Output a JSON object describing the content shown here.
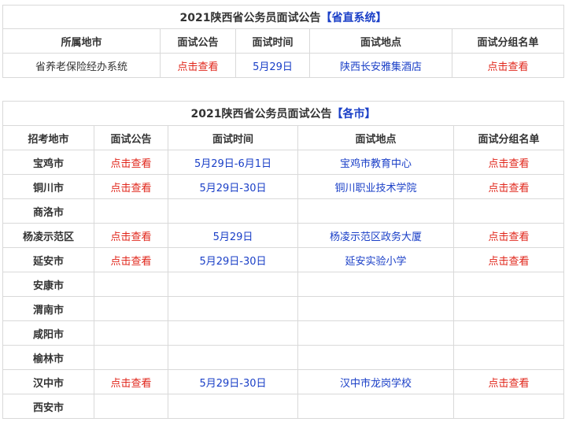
{
  "table1": {
    "title": "2021陕西省公务员面试公告",
    "title_accent": "【省直系统】",
    "headers": [
      "所属地市",
      "面试公告",
      "面试时间",
      "面试地点",
      "面试分组名单"
    ],
    "row": {
      "region": "省养老保险经办系统",
      "notice": "点击查看",
      "date": "5月29日",
      "place": "陕西长安雅集酒店",
      "groups": "点击查看"
    }
  },
  "table2": {
    "title": "2021陕西省公务员面试公告",
    "title_accent": "【各市】",
    "headers": [
      "招考地市",
      "面试公告",
      "面试时间",
      "面试地点",
      "面试分组名单"
    ],
    "rows": [
      {
        "city": "宝鸡市",
        "notice": "点击查看",
        "date": "5月29日-6月1日",
        "place": "宝鸡市教育中心",
        "groups": "点击查看"
      },
      {
        "city": "铜川市",
        "notice": "点击查看",
        "date": "5月29日-30日",
        "place": "铜川职业技术学院",
        "groups": "点击查看"
      },
      {
        "city": "商洛市",
        "notice": "",
        "date": "",
        "place": "",
        "groups": ""
      },
      {
        "city": "杨凌示范区",
        "notice": "点击查看",
        "date": "5月29日",
        "place": "杨凌示范区政务大厦",
        "groups": "点击查看"
      },
      {
        "city": "延安市",
        "notice": "点击查看",
        "date": "5月29日-30日",
        "place": "延安实验小学",
        "groups": "点击查看"
      },
      {
        "city": "安康市",
        "notice": "",
        "date": "",
        "place": "",
        "groups": ""
      },
      {
        "city": "渭南市",
        "notice": "",
        "date": "",
        "place": "",
        "groups": ""
      },
      {
        "city": "咸阳市",
        "notice": "",
        "date": "",
        "place": "",
        "groups": ""
      },
      {
        "city": "榆林市",
        "notice": "",
        "date": "",
        "place": "",
        "groups": ""
      },
      {
        "city": "汉中市",
        "notice": "点击查看",
        "date": "5月29日-30日",
        "place": "汉中市龙岗学校",
        "groups": "点击查看"
      },
      {
        "city": "西安市",
        "notice": "",
        "date": "",
        "place": "",
        "groups": ""
      }
    ]
  }
}
